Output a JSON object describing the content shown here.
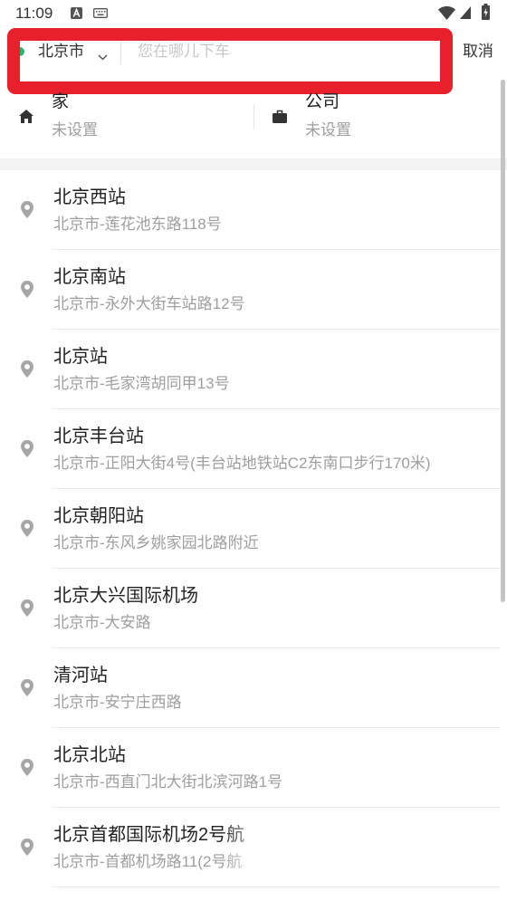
{
  "status_bar": {
    "time": "11:09",
    "left_icons": [
      "app-notification-icon",
      "keyboard-icon"
    ],
    "right_icons": [
      "wifi-icon",
      "signal-icon",
      "battery-charging-icon"
    ]
  },
  "search": {
    "city": "北京市",
    "city_icon": "chevron-down-icon",
    "value": "",
    "placeholder": "您在哪儿下车",
    "cancel_label": "取消"
  },
  "shortcuts": [
    {
      "icon": "home-icon",
      "label": "家",
      "status": "未设置"
    },
    {
      "icon": "briefcase-icon",
      "label": "公司",
      "status": "未设置"
    }
  ],
  "place_icon": "location-pin-icon",
  "places": [
    {
      "title": "北京西站",
      "address": "北京市-莲花池东路118号"
    },
    {
      "title": "北京南站",
      "address": "北京市-永外大街车站路12号"
    },
    {
      "title": "北京站",
      "address": "北京市-毛家湾胡同甲13号"
    },
    {
      "title": "北京丰台站",
      "address": "北京市-正阳大街4号(丰台站地铁站C2东南口步行170米)"
    },
    {
      "title": "北京朝阳站",
      "address": "北京市-东风乡姚家园北路附近"
    },
    {
      "title": "北京大兴国际机场",
      "address": "北京市-大安路"
    },
    {
      "title": "清河站",
      "address": "北京市-安宁庄西路"
    },
    {
      "title": "北京北站",
      "address": "北京市-西直门北大街北滨河路1号"
    },
    {
      "title": "北京首都国际机场2号航",
      "address": "北京市-首都机场路11(2号航"
    }
  ],
  "colors": {
    "highlight": "#e8202c",
    "origin_dot": "#2bb36f",
    "primary_text": "#222222",
    "secondary_text": "#9e9e9e",
    "placeholder": "#c8c8c8",
    "pin": "#a6a6a6"
  }
}
